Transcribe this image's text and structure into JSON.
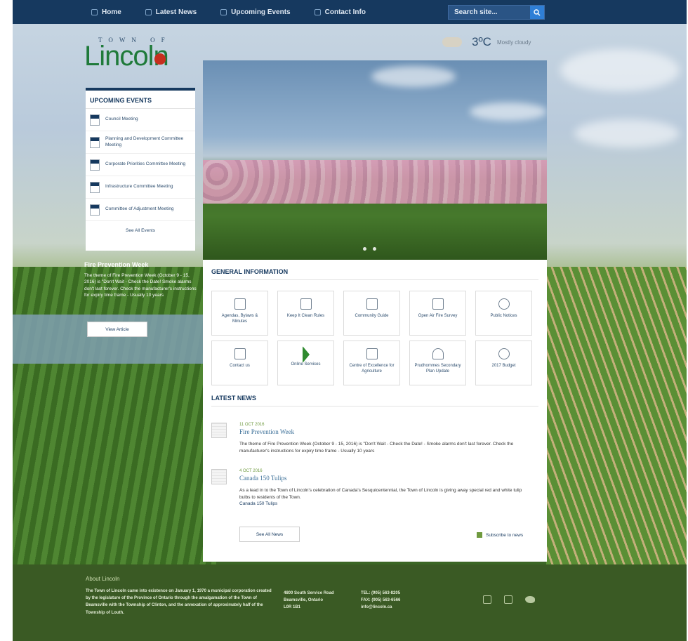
{
  "nav": {
    "items": [
      {
        "label": "Home",
        "icon": "home-icon"
      },
      {
        "label": "Latest News",
        "icon": "news-icon"
      },
      {
        "label": "Upcoming Events",
        "icon": "calendar-icon"
      },
      {
        "label": "Contact Info",
        "icon": "phone-icon"
      }
    ],
    "search_placeholder": "Search site...",
    "colors": {
      "bar": "#16395f",
      "search_button": "#2f7fd6"
    }
  },
  "logo": {
    "top": "TOWN OF",
    "main": "Lincoln"
  },
  "weather": {
    "temp": "3ºC",
    "desc": "Mostly cloudy"
  },
  "events": {
    "title": "UPCOMING EVENTS",
    "items": [
      {
        "label": "Council Meeting"
      },
      {
        "label": "Planning and Development Committee Meeting"
      },
      {
        "label": "Corporate Priorities Committee Meeting"
      },
      {
        "label": "Infrastructure Committee Meeting"
      },
      {
        "label": "Committee of Adjustment Meeting"
      }
    ],
    "more": "See All Events"
  },
  "feature": {
    "title": "Fire Prevention Week",
    "text": "The theme of Fire Prevention Week (October 9 - 15, 2016) is \"Don't Wait - Check the Date! Smoke alarms don't last forever. Check the manufacturer's instructions for expiry time frame - Usually 10 years",
    "button": "View Article"
  },
  "general": {
    "title": "GENERAL INFORMATION",
    "tiles": [
      {
        "label": "Agendas, Bylaws & Minutes",
        "icon": "document-icon"
      },
      {
        "label": "Keep It Clean Rules",
        "icon": "chat-icon"
      },
      {
        "label": "Community Guide",
        "icon": "book-icon"
      },
      {
        "label": "Open Air Fire Survey",
        "icon": "fire-icon"
      },
      {
        "label": "Public Notices",
        "icon": "info-icon"
      },
      {
        "label": "Contact us",
        "icon": "contact-icon"
      },
      {
        "label": "Online Services",
        "icon": "arrow-icon"
      },
      {
        "label": "Centre of Excellence for Agriculture",
        "icon": "building-icon"
      },
      {
        "label": "Prudhommes Secondary Plan Update",
        "icon": "person-icon"
      },
      {
        "label": "2017 Budget",
        "icon": "chart-icon"
      }
    ]
  },
  "news": {
    "title": "LATEST NEWS",
    "items": [
      {
        "date": "11 OCT 2016",
        "heading": "Fire Prevention Week",
        "text": "The theme of Fire Prevention Week (October 9 - 15, 2016) is \"Don't Wait - Check the Date! - Smoke alarms don't last forever. Check the manufacturer's instructions for expiry time frame - Usually 10 years",
        "link": ""
      },
      {
        "date": "4 OCT 2016",
        "heading": "Canada 150 Tulips",
        "text": "As a lead in to the Town of Lincoln's celebration of Canada's Sesquicentennial, the Town of Lincoln is giving away special red and white tulip bulbs to residents of the Town.",
        "link": "Canada 150 Tulips"
      }
    ],
    "more": "See All News",
    "subscribe": "Subscribe to news"
  },
  "footer": {
    "title": "About Lincoln",
    "text": "The Town of Lincoln came into existence on January 1, 1970 a municipal corporation created by the legislature of the Province of Ontario through the amalgamation of the Town of Beamsville with the Township of Clinton, and the annexation of approximately half of the Township of Louth.",
    "address": [
      "4800 South Service Road",
      "Beamsville, Ontario",
      "L0R 1B1"
    ],
    "contact": [
      "TEL: (905) 563-8205",
      "FAX: (905) 563-6566",
      "info@lincoln.ca"
    ],
    "social": [
      "youtube-icon",
      "facebook-icon",
      "twitter-icon"
    ]
  }
}
